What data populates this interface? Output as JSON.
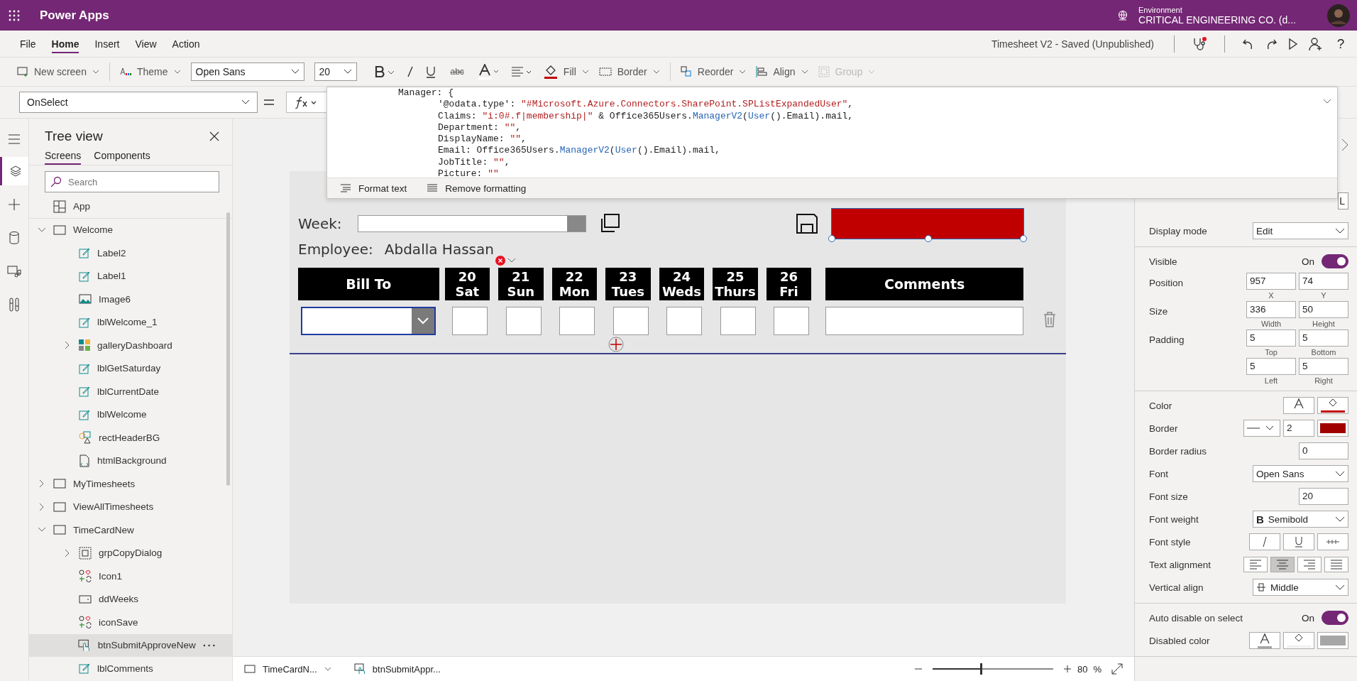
{
  "app_bar": {
    "title": "Power Apps",
    "environment_label": "Environment",
    "environment_name": "CRITICAL ENGINEERING CO. (d..."
  },
  "menu": {
    "tabs": [
      {
        "label": "File",
        "selected": false
      },
      {
        "label": "Home",
        "selected": true
      },
      {
        "label": "Insert",
        "selected": false
      },
      {
        "label": "View",
        "selected": false
      },
      {
        "label": "Action",
        "selected": false
      }
    ],
    "doc_title": "Timesheet V2 - Saved (Unpublished)",
    "help": "?"
  },
  "toolbar": {
    "new_screen": "New screen",
    "theme": "Theme",
    "font": "Open Sans",
    "font_size": "20",
    "strike": "abc",
    "fill": {
      "label": "Fill",
      "color": "#c00000"
    },
    "border": "Border",
    "reorder": "Reorder",
    "align": "Align",
    "group": "Group",
    "group_disabled": true
  },
  "formula": {
    "property": "OnSelect",
    "header": "Manager: {",
    "lines": [
      [
        {
          "kind": "plain",
          "text": "'@odata.type': "
        },
        {
          "kind": "string",
          "text": "\"#Microsoft.Azure.Connectors.SharePoint.SPListExpandedUser\""
        },
        {
          "kind": "plain",
          "text": ","
        }
      ],
      [
        {
          "kind": "plain",
          "text": "Claims: "
        },
        {
          "kind": "string",
          "text": "\"i:0#.f|membership|\""
        },
        {
          "kind": "plain",
          "text": " & Office365Users."
        },
        {
          "kind": "func",
          "text": "ManagerV2"
        },
        {
          "kind": "plain",
          "text": "("
        },
        {
          "kind": "func",
          "text": "User"
        },
        {
          "kind": "plain",
          "text": "().Email).mail,"
        }
      ],
      [
        {
          "kind": "plain",
          "text": "Department: "
        },
        {
          "kind": "string",
          "text": "\"\""
        },
        {
          "kind": "plain",
          "text": ","
        }
      ],
      [
        {
          "kind": "plain",
          "text": "DisplayName: "
        },
        {
          "kind": "string",
          "text": "\"\""
        },
        {
          "kind": "plain",
          "text": ","
        }
      ],
      [
        {
          "kind": "plain",
          "text": "Email: Office365Users."
        },
        {
          "kind": "func",
          "text": "ManagerV2"
        },
        {
          "kind": "plain",
          "text": "("
        },
        {
          "kind": "func",
          "text": "User"
        },
        {
          "kind": "plain",
          "text": "().Email).mail,"
        }
      ],
      [
        {
          "kind": "plain",
          "text": "JobTitle: "
        },
        {
          "kind": "string",
          "text": "\"\""
        },
        {
          "kind": "plain",
          "text": ","
        }
      ],
      [
        {
          "kind": "plain",
          "text": "Picture: "
        },
        {
          "kind": "string",
          "text": "\"\""
        }
      ]
    ],
    "format_text": "Format text",
    "remove_formatting": "Remove formatting"
  },
  "tree": {
    "title": "Tree view",
    "tabs": [
      {
        "label": "Screens",
        "selected": true
      },
      {
        "label": "Components",
        "selected": false
      }
    ],
    "search": {
      "placeholder": "Search"
    },
    "items": [
      {
        "label": "App",
        "kind": "app",
        "selected": false
      },
      {
        "label": "Welcome",
        "kind": "screen",
        "selected": false,
        "expanded": true,
        "children": [
          {
            "label": "Label2",
            "kind": "label",
            "selected": false
          },
          {
            "label": "Label1",
            "kind": "label",
            "selected": false
          },
          {
            "label": "Image6",
            "kind": "image",
            "selected": false
          },
          {
            "label": "lblWelcome_1",
            "kind": "label",
            "selected": false
          },
          {
            "label": "galleryDashboard",
            "kind": "gallery",
            "selected": false,
            "expanded": false
          },
          {
            "label": "lblGetSaturday",
            "kind": "label",
            "selected": false
          },
          {
            "label": "lblCurrentDate",
            "kind": "label",
            "selected": false
          },
          {
            "label": "lblWelcome",
            "kind": "label",
            "selected": false
          },
          {
            "label": "rectHeaderBG",
            "kind": "shapes",
            "selected": false
          },
          {
            "label": "htmlBackground",
            "kind": "html",
            "selected": false
          }
        ]
      },
      {
        "label": "MyTimesheets",
        "kind": "screen",
        "selected": false,
        "expanded": false
      },
      {
        "label": "ViewAllTimesheets",
        "kind": "screen",
        "selected": false,
        "expanded": false
      },
      {
        "label": "TimeCardNew",
        "kind": "screen",
        "selected": false,
        "expanded": true,
        "children": [
          {
            "label": "grpCopyDialog",
            "kind": "group",
            "selected": false,
            "expanded": false
          },
          {
            "label": "Icon1",
            "kind": "icons",
            "selected": false
          },
          {
            "label": "ddWeeks",
            "kind": "dropdown",
            "selected": false
          },
          {
            "label": "iconSave",
            "kind": "icons",
            "selected": false
          },
          {
            "label": "btnSubmitApproveNew",
            "kind": "button",
            "selected": true
          },
          {
            "label": "lblComments",
            "kind": "label",
            "selected": false
          }
        ]
      }
    ]
  },
  "canvas": {
    "week_label": "Week:",
    "employee_label": "Employee:",
    "employee_name": "Abdalla Hassan",
    "submit_button": {
      "color": "#c00000"
    },
    "columns": [
      {
        "kind": "wide",
        "label": "Bill To"
      },
      {
        "kind": "day",
        "date": "20",
        "day": "Sat"
      },
      {
        "kind": "day",
        "date": "21",
        "day": "Sun"
      },
      {
        "kind": "day",
        "date": "22",
        "day": "Mon"
      },
      {
        "kind": "day",
        "date": "23",
        "day": "Tues"
      },
      {
        "kind": "day",
        "date": "24",
        "day": "Weds"
      },
      {
        "kind": "day",
        "date": "25",
        "day": "Thurs"
      },
      {
        "kind": "day",
        "date": "26",
        "day": "Fri"
      },
      {
        "kind": "comments",
        "label": "Comments"
      }
    ]
  },
  "properties": {
    "peek_value": "L",
    "sections": [
      [
        {
          "kind": "select",
          "label": "Display mode",
          "value": "Edit"
        }
      ],
      [
        {
          "kind": "toggle",
          "label": "Visible",
          "state_text": "On",
          "on": true
        },
        {
          "kind": "pair",
          "label": "Position",
          "fields": [
            {
              "value": "957",
              "caption": "X"
            },
            {
              "value": "74",
              "caption": "Y"
            }
          ]
        },
        {
          "kind": "pair",
          "label": "Size",
          "fields": [
            {
              "value": "336",
              "caption": "Width"
            },
            {
              "value": "50",
              "caption": "Height"
            }
          ]
        },
        {
          "kind": "pair",
          "label": "Padding",
          "fields": [
            {
              "value": "5",
              "caption": "Top"
            },
            {
              "value": "5",
              "caption": "Bottom"
            }
          ]
        },
        {
          "kind": "pair",
          "fields": [
            {
              "value": "5",
              "caption": "Left"
            },
            {
              "value": "5",
              "caption": "Right"
            }
          ]
        }
      ],
      [
        {
          "kind": "colors",
          "label": "Color",
          "swatches": [
            {
              "kind": "text",
              "color": "#ffffff"
            },
            {
              "kind": "fill",
              "color": "#c00000"
            }
          ]
        },
        {
          "kind": "border",
          "label": "Border",
          "value": "2",
          "color": "#a00000"
        },
        {
          "kind": "number",
          "label": "Border radius",
          "value": "0"
        },
        {
          "kind": "select",
          "label": "Font",
          "value": "Open Sans"
        },
        {
          "kind": "number",
          "label": "Font size",
          "value": "20"
        },
        {
          "kind": "select",
          "label": "Font weight",
          "value": "Semibold",
          "prefix": "B"
        },
        {
          "kind": "styles",
          "label": "Font style"
        },
        {
          "kind": "align",
          "label": "Text alignment",
          "options": [
            {
              "kind": "left",
              "selected": false
            },
            {
              "kind": "center",
              "selected": true
            },
            {
              "kind": "right",
              "selected": false
            },
            {
              "kind": "justify",
              "selected": false
            }
          ]
        },
        {
          "kind": "valign",
          "label": "Vertical align",
          "value": "Middle"
        }
      ],
      [
        {
          "kind": "toggle",
          "label": "Auto disable on select",
          "state_text": "On",
          "on": true
        },
        {
          "kind": "colors",
          "label": "Disabled color",
          "swatches": [
            {
              "kind": "text",
              "color": "#a6a6a6"
            },
            {
              "kind": "fill",
              "color": "#f0f0f0"
            },
            {
              "kind": "block",
              "color": "#a6a6a6"
            }
          ]
        }
      ]
    ]
  },
  "status_bar": {
    "screen": "TimeCardN...",
    "control": "btnSubmitAppr...",
    "zoom": {
      "level": 0.4
    },
    "zoom_value": "80",
    "zoom_unit": "%"
  }
}
